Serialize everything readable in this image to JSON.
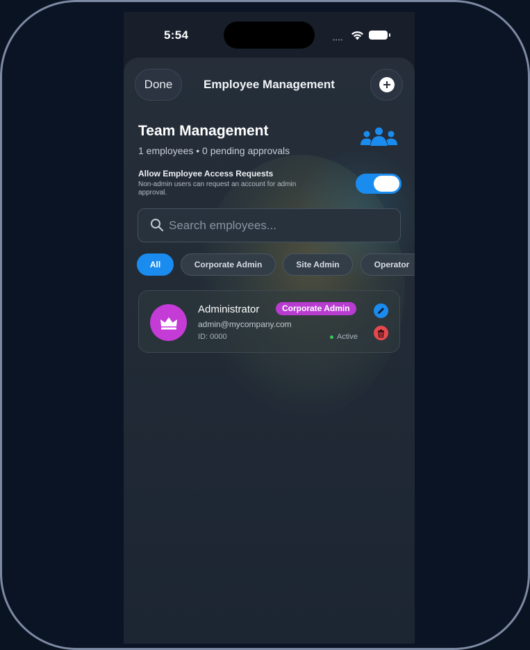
{
  "status_bar": {
    "time": "5:54"
  },
  "nav": {
    "done_label": "Done",
    "title": "Employee Management"
  },
  "team": {
    "title": "Team Management",
    "summary": "1 employees • 0 pending approvals"
  },
  "access": {
    "title": "Allow Employee Access Requests",
    "description": "Non-admin users can request an account for admin approval.",
    "enabled": true
  },
  "search": {
    "placeholder": "Search employees...",
    "value": ""
  },
  "filters": [
    {
      "label": "All",
      "active": true
    },
    {
      "label": "Corporate Admin",
      "active": false
    },
    {
      "label": "Site Admin",
      "active": false
    },
    {
      "label": "Operator",
      "active": false
    }
  ],
  "employees": [
    {
      "name": "Administrator",
      "role": "Corporate Admin",
      "email": "admin@mycompany.com",
      "id": "ID: 0000",
      "status": "Active",
      "avatar_icon": "crown-icon"
    }
  ],
  "colors": {
    "accent": "#1a8cf0",
    "role_badge": "#b73ccf",
    "avatar": "#c43bd6",
    "delete": "#e5484d",
    "active_dot": "#35c85a"
  }
}
